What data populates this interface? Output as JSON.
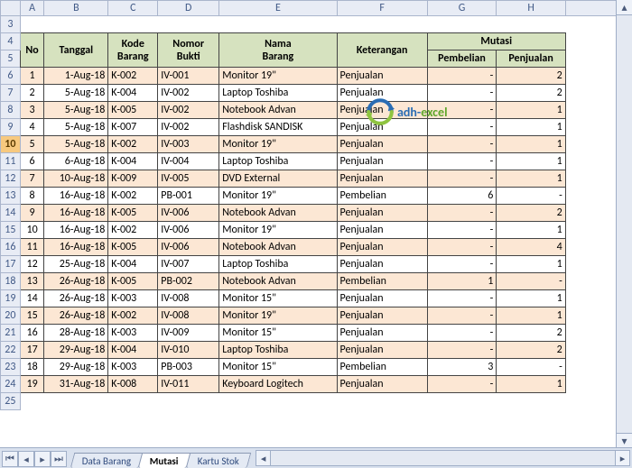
{
  "columns": [
    "A",
    "B",
    "C",
    "D",
    "E",
    "F",
    "G",
    "H"
  ],
  "row_start": 3,
  "row_end": 25,
  "selected_row": 10,
  "headers": {
    "no": "No",
    "tanggal": "Tanggal",
    "kode_barang": "Kode Barang",
    "nomor_bukti": "Nomor Bukti",
    "nama_barang": "Nama Barang",
    "keterangan": "Keterangan",
    "mutasi": "Mutasi",
    "pembelian": "Pembelian",
    "penjualan": "Penjualan"
  },
  "rows": [
    {
      "no": "1",
      "tgl": "1-Aug-18",
      "kode": "K-002",
      "bukti": "IV-001",
      "nama": "Monitor 19\"",
      "ket": "Penjualan",
      "beli": "-",
      "jual": "2"
    },
    {
      "no": "2",
      "tgl": "5-Aug-18",
      "kode": "K-004",
      "bukti": "IV-002",
      "nama": "Laptop Toshiba",
      "ket": "Penjualan",
      "beli": "-",
      "jual": "2"
    },
    {
      "no": "3",
      "tgl": "5-Aug-18",
      "kode": "K-005",
      "bukti": "IV-002",
      "nama": "Notebook Advan",
      "ket": "Penjualan",
      "beli": "-",
      "jual": "1"
    },
    {
      "no": "4",
      "tgl": "5-Aug-18",
      "kode": "K-007",
      "bukti": "IV-002",
      "nama": "Flashdisk SANDISK",
      "ket": "Penjualan",
      "beli": "-",
      "jual": "1"
    },
    {
      "no": "5",
      "tgl": "5-Aug-18",
      "kode": "K-002",
      "bukti": "IV-003",
      "nama": "Monitor 19\"",
      "ket": "Penjualan",
      "beli": "-",
      "jual": "1"
    },
    {
      "no": "6",
      "tgl": "6-Aug-18",
      "kode": "K-004",
      "bukti": "IV-004",
      "nama": "Laptop Toshiba",
      "ket": "Penjualan",
      "beli": "-",
      "jual": "1"
    },
    {
      "no": "7",
      "tgl": "10-Aug-18",
      "kode": "K-009",
      "bukti": "IV-005",
      "nama": "DVD External",
      "ket": "Penjualan",
      "beli": "-",
      "jual": "1"
    },
    {
      "no": "8",
      "tgl": "16-Aug-18",
      "kode": "K-002",
      "bukti": "PB-001",
      "nama": "Monitor 19\"",
      "ket": "Pembelian",
      "beli": "6",
      "jual": "-"
    },
    {
      "no": "9",
      "tgl": "16-Aug-18",
      "kode": "K-005",
      "bukti": "IV-006",
      "nama": "Notebook Advan",
      "ket": "Penjualan",
      "beli": "-",
      "jual": "2"
    },
    {
      "no": "10",
      "tgl": "16-Aug-18",
      "kode": "K-002",
      "bukti": "IV-006",
      "nama": "Monitor 19\"",
      "ket": "Penjualan",
      "beli": "-",
      "jual": "1"
    },
    {
      "no": "11",
      "tgl": "16-Aug-18",
      "kode": "K-005",
      "bukti": "IV-006",
      "nama": "Notebook Advan",
      "ket": "Penjualan",
      "beli": "-",
      "jual": "4"
    },
    {
      "no": "12",
      "tgl": "25-Aug-18",
      "kode": "K-004",
      "bukti": "IV-007",
      "nama": "Laptop Toshiba",
      "ket": "Penjualan",
      "beli": "-",
      "jual": "1"
    },
    {
      "no": "13",
      "tgl": "26-Aug-18",
      "kode": "K-005",
      "bukti": "PB-002",
      "nama": "Notebook Advan",
      "ket": "Pembelian",
      "beli": "1",
      "jual": "-"
    },
    {
      "no": "14",
      "tgl": "26-Aug-18",
      "kode": "K-003",
      "bukti": "IV-008",
      "nama": "Monitor 15\"",
      "ket": "Penjualan",
      "beli": "-",
      "jual": "1"
    },
    {
      "no": "15",
      "tgl": "26-Aug-18",
      "kode": "K-002",
      "bukti": "IV-008",
      "nama": "Monitor 19\"",
      "ket": "Penjualan",
      "beli": "-",
      "jual": "1"
    },
    {
      "no": "16",
      "tgl": "28-Aug-18",
      "kode": "K-003",
      "bukti": "IV-009",
      "nama": "Monitor 15\"",
      "ket": "Penjualan",
      "beli": "-",
      "jual": "2"
    },
    {
      "no": "17",
      "tgl": "29-Aug-18",
      "kode": "K-004",
      "bukti": "IV-010",
      "nama": "Laptop Toshiba",
      "ket": "Penjualan",
      "beli": "-",
      "jual": "2"
    },
    {
      "no": "18",
      "tgl": "29-Aug-18",
      "kode": "K-003",
      "bukti": "PB-003",
      "nama": "Monitor 15\"",
      "ket": "Pembelian",
      "beli": "3",
      "jual": "-"
    },
    {
      "no": "19",
      "tgl": "31-Aug-18",
      "kode": "K-008",
      "bukti": "IV-011",
      "nama": "Keyboard Logitech",
      "ket": "Penjualan",
      "beli": "-",
      "jual": "1"
    }
  ],
  "sheet_tabs": [
    {
      "label": "Data Barang",
      "active": false
    },
    {
      "label": "Mutasi",
      "active": true
    },
    {
      "label": "Kartu Stok",
      "active": false
    }
  ],
  "watermark": {
    "text1": "adh-",
    "text2": "excel"
  }
}
